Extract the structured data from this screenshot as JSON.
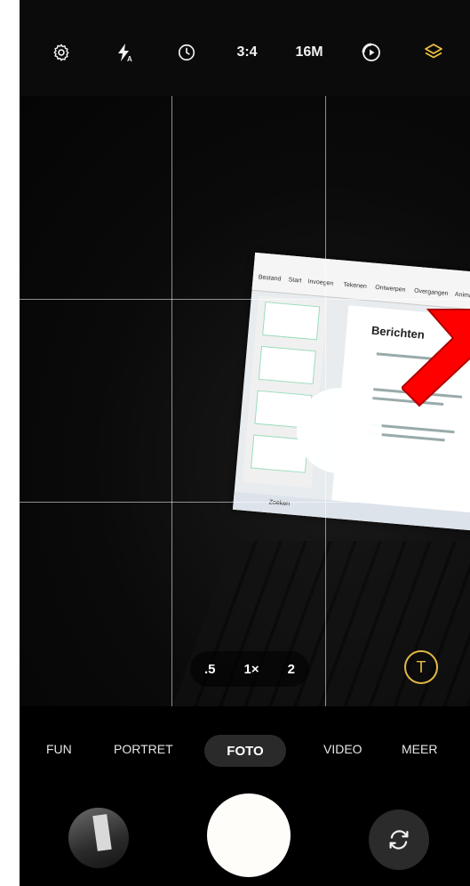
{
  "top_bar": {
    "settings_icon": "gear-icon",
    "flash_icon": "flash-auto-icon",
    "timer_icon": "timer-icon",
    "aspect_ratio": "3:4",
    "resolution": "16M",
    "motion_photo_icon": "motion-photo-icon",
    "filters_icon": "layers-icon",
    "filters_color": "#f0c040"
  },
  "zoom": {
    "options": [
      ".5",
      "1×",
      "2"
    ],
    "selected": "1×"
  },
  "scene_text_button": "T",
  "modes": {
    "items": [
      "FUN",
      "PORTRET",
      "FOTO",
      "VIDEO",
      "MEER"
    ],
    "selected": "FOTO"
  },
  "preview_content": {
    "screen_title": "Berichten",
    "ribbon_tabs": [
      "Bestand",
      "Start",
      "Invoegen",
      "Tekenen",
      "Ontwerpen",
      "Overgangen",
      "Animaties"
    ],
    "taskbar_text": "Zoeken",
    "arrow_color": "#ff0000"
  },
  "bottom": {
    "gallery_icon": "gallery-thumbnail",
    "shutter_icon": "shutter-button",
    "switch_camera_icon": "switch-camera-icon"
  }
}
